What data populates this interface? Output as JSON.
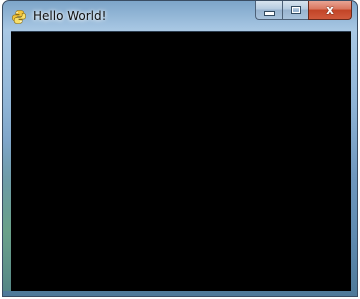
{
  "window": {
    "title": "Hello World!",
    "app_icon": "pygame-snake-icon"
  },
  "caption_buttons": {
    "minimize_icon": "minimize-icon",
    "maximize_icon": "maximize-icon",
    "close_icon": "close-icon",
    "close_glyph": "x"
  },
  "client": {
    "background": "#000000"
  },
  "colors": {
    "close_button": "#c24427",
    "frame": "#8fb4d6"
  }
}
